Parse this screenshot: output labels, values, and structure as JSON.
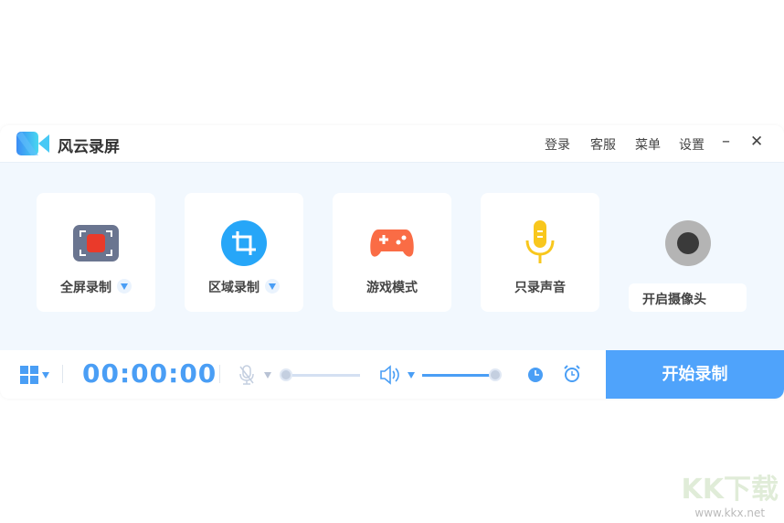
{
  "app": {
    "title": "风云录屏"
  },
  "header": {
    "menu": [
      "登录",
      "客服",
      "菜单",
      "设置"
    ]
  },
  "modes": [
    {
      "label": "全屏录制",
      "dropdown": true
    },
    {
      "label": "区域录制",
      "dropdown": true
    },
    {
      "label": "游戏模式",
      "dropdown": false
    },
    {
      "label": "只录声音",
      "dropdown": false
    }
  ],
  "camera": {
    "label": "开启摄像头"
  },
  "toolbar": {
    "timer": "00:00:00",
    "mic_level": 0,
    "speaker_level": 100,
    "start_label": "开始录制"
  },
  "colors": {
    "accent": "#4fa3fb",
    "bg": "#f2f8fe"
  },
  "watermark": {
    "brand": "KK下载",
    "url": "www.kkx.net"
  }
}
